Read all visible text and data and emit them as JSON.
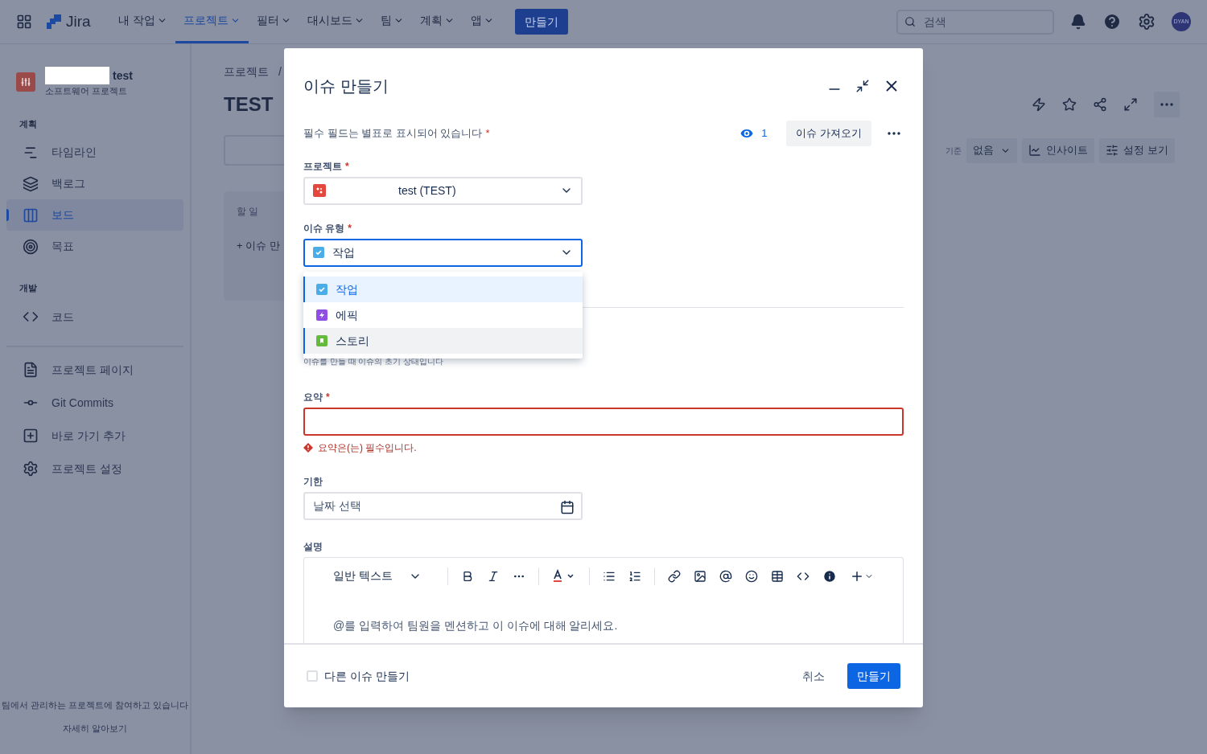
{
  "topnav": {
    "app_name": "Jira",
    "items": [
      {
        "label": "내 작업",
        "selected": false
      },
      {
        "label": "프로젝트",
        "selected": true
      },
      {
        "label": "필터",
        "selected": false
      },
      {
        "label": "대시보드",
        "selected": false
      },
      {
        "label": "팀",
        "selected": false
      },
      {
        "label": "계획",
        "selected": false
      },
      {
        "label": "앱",
        "selected": false
      }
    ],
    "create_button": "만들기",
    "search_placeholder": "검색",
    "avatar": "DYAN"
  },
  "sidebar": {
    "project_name": "test",
    "project_type": "소프트웨어 프로젝트",
    "sections": [
      {
        "heading": "계획",
        "items": [
          {
            "label": "타임라인",
            "kind": "timeline",
            "selected": false
          },
          {
            "label": "백로그",
            "kind": "backlog",
            "selected": false
          },
          {
            "label": "보드",
            "kind": "board",
            "selected": true
          },
          {
            "label": "목표",
            "kind": "goals",
            "selected": false
          }
        ]
      },
      {
        "heading": "개발",
        "items": [
          {
            "label": "코드",
            "kind": "code",
            "selected": false
          }
        ]
      }
    ],
    "links": [
      {
        "label": "프로젝트 페이지",
        "kind": "page"
      },
      {
        "label": "Git Commits",
        "kind": "git"
      },
      {
        "label": "바로 가기 추가",
        "kind": "shortcut"
      },
      {
        "label": "프로젝트 설정",
        "kind": "settings"
      }
    ],
    "footer_text": "팀에서 관리하는 프로젝트에 참여하고 있습니다",
    "footer_link": "자세히 알아보기"
  },
  "board": {
    "breadcrumb": "프로젝트",
    "breadcrumb_separator": "/",
    "title": "TEST",
    "group_label": "기준",
    "group_value": "없음",
    "insights_button": "인사이트",
    "view_settings_button": "설정 보기",
    "column_title": "할 일",
    "create_issue": "+ 이슈 만"
  },
  "modal": {
    "title": "이슈 만들기",
    "required_note": "필수 필드는 별표로 표시되어 있습니다",
    "required_note_mark": "*",
    "watchers": "1",
    "import_button": "이슈 가져오기",
    "project": {
      "label": "프로젝트",
      "required_mark": "*",
      "value": "test (TEST)"
    },
    "issue_type": {
      "label": "이슈 유형",
      "required_mark": "*",
      "value": "작업",
      "expanded": true,
      "options": [
        {
          "label": "작업",
          "kind": "task",
          "selected": true,
          "hovered": false
        },
        {
          "label": "에픽",
          "kind": "epic",
          "selected": false,
          "hovered": false
        },
        {
          "label": "스토리",
          "kind": "story",
          "selected": false,
          "hovered": true
        }
      ]
    },
    "status_hint": "이슈를 만들 때 이슈의 초기 상태입니다",
    "summary": {
      "label": "요약",
      "required_mark": "*",
      "invalid": true,
      "error": "요약은(는) 필수입니다."
    },
    "due": {
      "label": "기한",
      "placeholder": "날짜 선택"
    },
    "description": {
      "label": "설명",
      "text_style": "일반 텍스트",
      "placeholder": "@를 입력하여 팀원을 멘션하고 이 이슈에 대해 알리세요."
    },
    "create_another": {
      "label": "다른 이슈 만들기",
      "checked": false
    },
    "cancel_button": "취소",
    "create_button": "만들기"
  }
}
